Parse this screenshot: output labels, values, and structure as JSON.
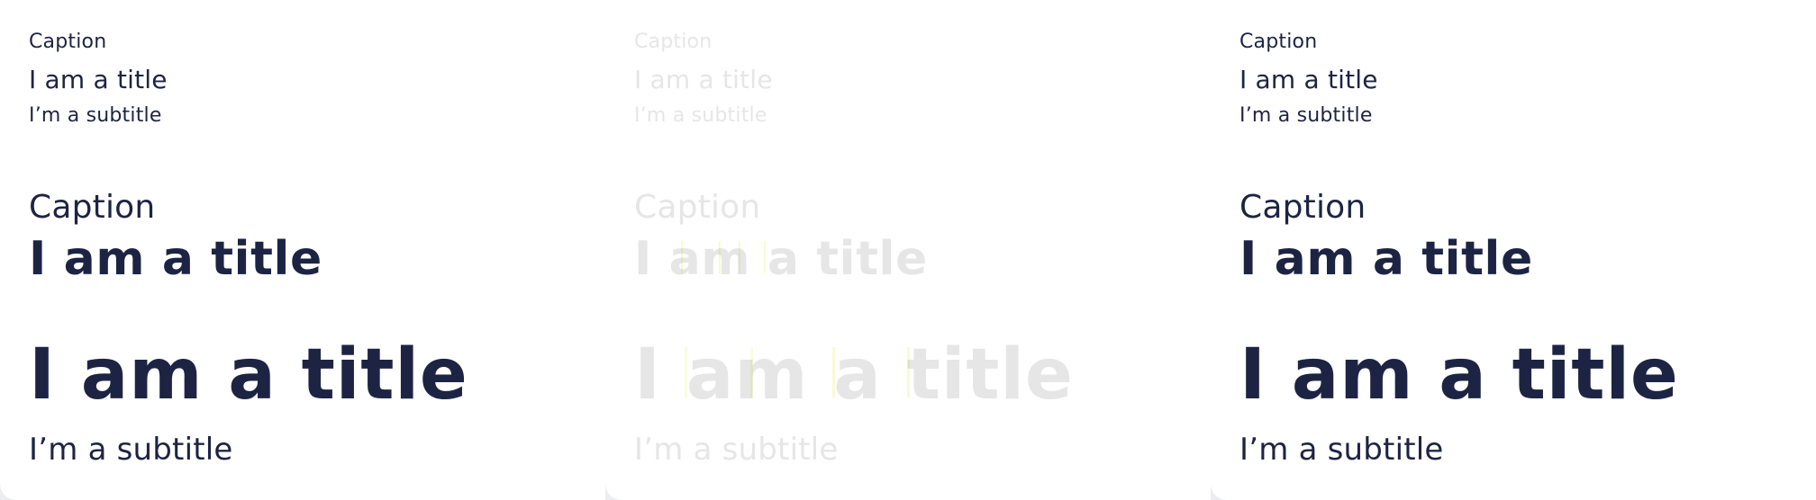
{
  "panels": [
    {
      "caption_small": "Caption",
      "title_small": "I am a title",
      "subtitle_small": "I’m a subtitle",
      "caption_mid": "Caption",
      "title_mid": "I am a title",
      "title_big": "I am a title",
      "subtitle_big": "I’m a subtitle"
    },
    {
      "caption_small": "Caption",
      "title_small": "I am a title",
      "subtitle_small": "I’m a subtitle",
      "caption_mid": "Caption",
      "title_mid": "I am a title",
      "title_big": "I am a title",
      "subtitle_big": "I’m a subtitle"
    },
    {
      "caption_small": "Caption",
      "title_small": "I am a title",
      "subtitle_small": "I’m a subtitle",
      "caption_mid": "Caption",
      "title_mid": "I am a title",
      "title_big": "I am a title",
      "subtitle_big": "I’m a subtitle"
    }
  ],
  "colors": {
    "ink": "#1d2443",
    "faded_ink": "#e6e6e6",
    "background": "#ffffff",
    "frame": "#ecedf0"
  }
}
